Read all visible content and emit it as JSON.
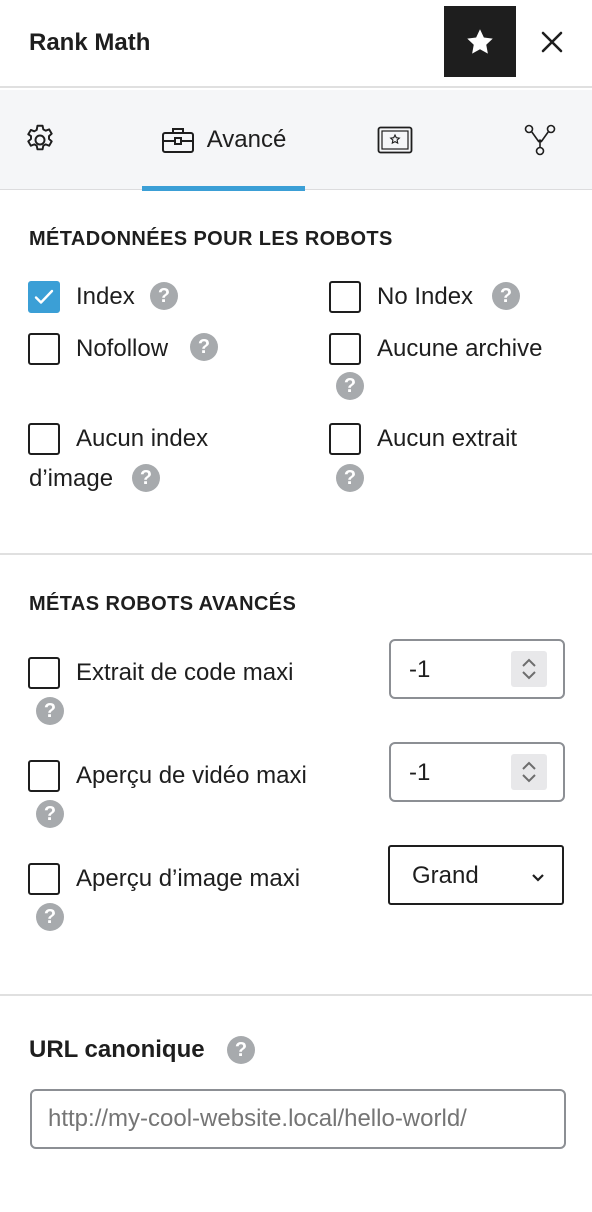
{
  "header": {
    "title": "Rank Math"
  },
  "tabs": {
    "advanced_label": "Avancé"
  },
  "robots_meta": {
    "title": "MÉTADONNÉES POUR LES ROBOTS",
    "items": [
      {
        "label": "Index",
        "checked": true
      },
      {
        "label": "No Index",
        "checked": false
      },
      {
        "label": "Nofollow",
        "checked": false
      },
      {
        "label": "Aucune archive",
        "checked": false
      },
      {
        "label_line1": "Aucun index",
        "label_line2": "d’image",
        "checked": false
      },
      {
        "label": "Aucun extrait",
        "checked": false
      }
    ]
  },
  "advanced_robots": {
    "title": "MÉTAS ROBOTS AVANCÉS",
    "snippet": {
      "label": "Extrait de code maxi",
      "value": "-1",
      "checked": false
    },
    "video": {
      "label": "Aperçu de vidéo maxi",
      "value": "-1",
      "checked": false
    },
    "image": {
      "label": "Aperçu d’image maxi",
      "value": "Grand",
      "checked": false
    }
  },
  "canonical": {
    "title": "URL canonique",
    "placeholder": "http://my-cool-website.local/hello-world/"
  },
  "help_glyph": "?",
  "colors": {
    "accent": "#3b9fd6",
    "dark": "#1e1e1e",
    "help": "#a7aaad"
  }
}
